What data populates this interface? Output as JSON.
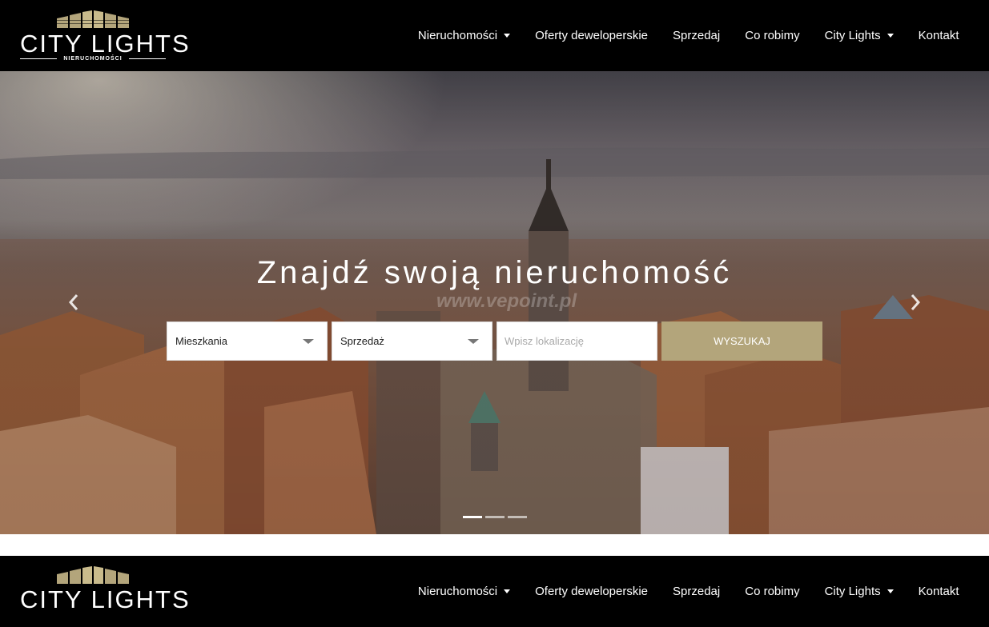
{
  "brand": {
    "name": "CITY LIGHTS",
    "tagline": "NIERUCHOMOŚCI",
    "accent": "#b3a57b"
  },
  "nav": {
    "items": [
      {
        "label": "Nieruchomości",
        "dropdown": true
      },
      {
        "label": "Oferty deweloperskie",
        "dropdown": false
      },
      {
        "label": "Sprzedaj",
        "dropdown": false
      },
      {
        "label": "Co robimy",
        "dropdown": false
      },
      {
        "label": "City Lights",
        "dropdown": true
      },
      {
        "label": "Kontakt",
        "dropdown": false
      }
    ]
  },
  "hero": {
    "title": "Znajdź swoją nieruchomość",
    "watermark": "www.vepoint.pl",
    "arrows": {
      "prev": "chevron-left-icon",
      "next": "chevron-right-icon"
    },
    "slides": 3,
    "active_slide": 1
  },
  "search": {
    "type_value": "Mieszkania",
    "transaction_value": "Sprzedaż",
    "location_placeholder": "Wpisz lokalizację",
    "submit_label": "WYSZUKAJ"
  }
}
